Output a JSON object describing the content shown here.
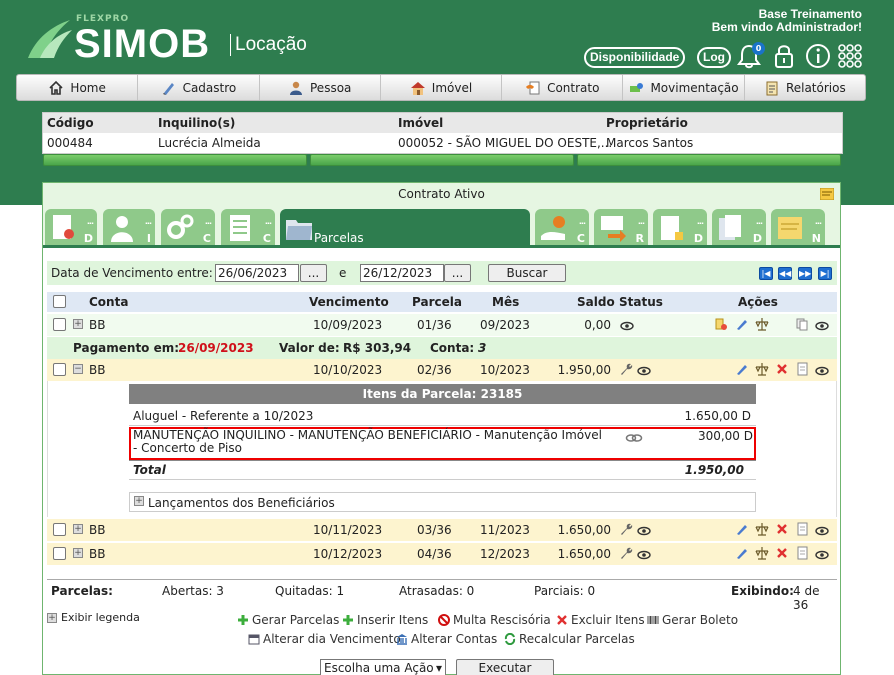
{
  "brand": {
    "top": "FLEXPRO",
    "name": "SIMOB",
    "sub": "Locação"
  },
  "user": {
    "line1": "Base Treinamento",
    "line2": "Bem vindo Administrador!"
  },
  "top_buttons": {
    "disponibilidade": "Disponibilidade",
    "log": "Log",
    "notifications": "0"
  },
  "icons": {
    "bell": "bell-icon",
    "lock": "lock-icon",
    "info": "info-icon",
    "apps": "apps-grid-icon"
  },
  "menu": [
    {
      "label": "Home",
      "icon": "home-icon"
    },
    {
      "label": "Cadastro",
      "icon": "pencil-icon"
    },
    {
      "label": "Pessoa",
      "icon": "person-icon"
    },
    {
      "label": "Imóvel",
      "icon": "house-icon"
    },
    {
      "label": "Contrato",
      "icon": "contract-icon"
    },
    {
      "label": "Movimentação",
      "icon": "money-icon"
    },
    {
      "label": "Relatórios",
      "icon": "report-icon"
    }
  ],
  "info": {
    "headers": [
      "Código",
      "Inquilino(s)",
      "Imóvel",
      "Proprietário"
    ],
    "values": [
      "000484",
      "Lucrécia Almeida",
      "000052 - SÃO MIGUEL DO OESTE,...",
      "Marcos Santos"
    ]
  },
  "panel": {
    "title": "Contrato Ativo"
  },
  "tabs": [
    {
      "letter": "D",
      "dots": "..."
    },
    {
      "letter": "I",
      "dots": "..."
    },
    {
      "letter": "C",
      "dots": "..."
    },
    {
      "letter": "C",
      "dots": "..."
    },
    {
      "label": "Parcelas",
      "dots": ""
    },
    {
      "letter": "C",
      "dots": "..."
    },
    {
      "letter": "R",
      "dots": "..."
    },
    {
      "letter": "D",
      "dots": "..."
    },
    {
      "letter": "D",
      "dots": "..."
    },
    {
      "letter": "N",
      "dots": "..."
    }
  ],
  "filter": {
    "label": "Data de Vencimento entre:",
    "from": "26/06/2023",
    "to": "26/12/2023",
    "and": "e",
    "dots": "...",
    "search": "Buscar",
    "nav": [
      "|◀",
      "◀◀",
      "▶▶",
      "▶|"
    ]
  },
  "table": {
    "headers": [
      "Conta",
      "Vencimento",
      "Parcela",
      "Mês",
      "Saldo",
      "Status",
      "Ações"
    ],
    "rows": [
      {
        "conta": "BB",
        "venc": "10/09/2023",
        "parcela": "01/36",
        "mes": "09/2023",
        "saldo": "0,00"
      },
      {
        "conta": "BB",
        "venc": "10/10/2023",
        "parcela": "02/36",
        "mes": "10/2023",
        "saldo": "1.950,00"
      },
      {
        "conta": "BB",
        "venc": "10/11/2023",
        "parcela": "03/36",
        "mes": "11/2023",
        "saldo": "1.650,00"
      },
      {
        "conta": "BB",
        "venc": "10/12/2023",
        "parcela": "04/36",
        "mes": "12/2023",
        "saldo": "1.650,00"
      }
    ]
  },
  "payment": {
    "label_date": "Pagamento em:",
    "date": "26/09/2023",
    "label_value": "Valor de:",
    "value": "R$ 303,94",
    "label_conta": "Conta:",
    "conta": "3"
  },
  "items": {
    "title": "Itens da Parcela: 23185",
    "rows": [
      {
        "desc": "Aluguel - Referente a 10/2023",
        "value": "1.650,00 D"
      },
      {
        "desc": "MANUTENÇÃO INQUILINO - MANUTENÇÃO BENEFICIÁRIO - Manutenção Imóvel - Concerto de Piso",
        "value": "300,00 D"
      }
    ],
    "total_label": "Total",
    "total": "1.950,00",
    "lancamentos": "Lançamentos dos Beneficiários"
  },
  "summary": {
    "parcelas": "Parcelas:",
    "abertas": "Abertas: 3",
    "quitadas": "Quitadas: 1",
    "atrasadas": "Atrasadas: 0",
    "parciais": "Parciais: 0",
    "exibindo_label": "Exibindo:",
    "exibindo": "4 de 36"
  },
  "legend": "Exibir legenda",
  "actions": {
    "gerar_parcelas": "Gerar Parcelas",
    "inserir_itens": "Inserir Itens",
    "multa": "Multa Rescisória",
    "excluir": "Excluir Itens",
    "boleto": "Gerar Boleto",
    "alterar_dia": "Alterar dia Vencimento",
    "alterar_contas": "Alterar Contas",
    "recalcular": "Recalcular Parcelas"
  },
  "bottom": {
    "select": "Escolha uma Ação",
    "execute": "Executar"
  },
  "colors": {
    "brand_green": "#2e7d4f",
    "light_green": "#dff5dc",
    "red": "#e00000"
  }
}
